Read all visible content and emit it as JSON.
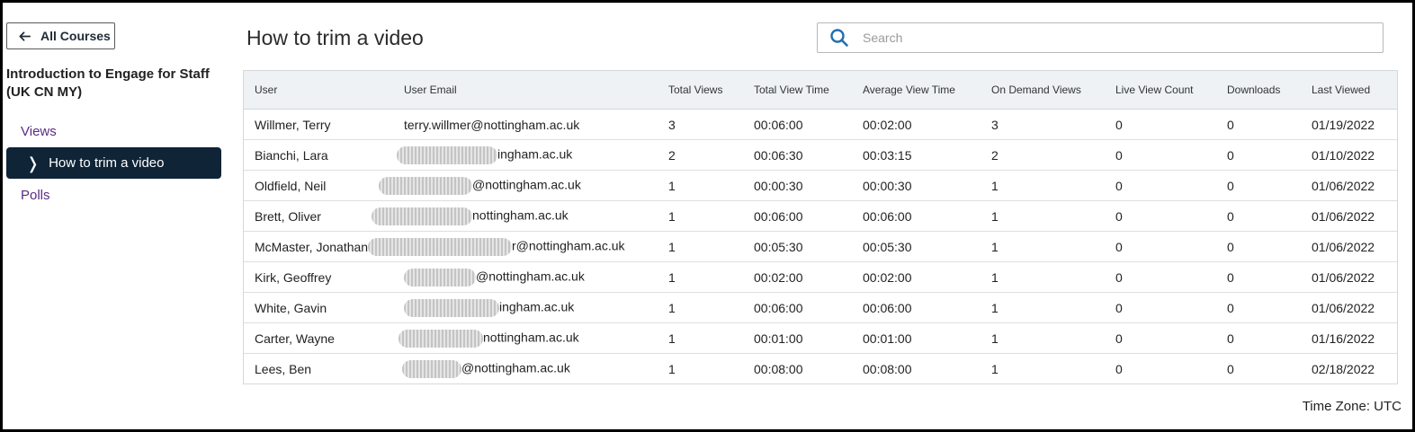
{
  "sidebar": {
    "back_label": "All Courses",
    "course_title": "Introduction to Engage for Staff (UK CN MY)",
    "items": [
      {
        "label": "Views",
        "active": false
      },
      {
        "label": "How to trim a video",
        "active": true
      },
      {
        "label": "Polls",
        "active": false
      }
    ]
  },
  "header": {
    "title": "How to trim a video",
    "search_placeholder": "Search"
  },
  "table": {
    "columns": [
      "User",
      "User Email",
      "Total Views",
      "Total View Time",
      "Average View Time",
      "On Demand Views",
      "Live View Count",
      "Downloads",
      "Last Viewed"
    ],
    "rows": [
      {
        "user": "Willmer, Terry",
        "email_visible": "terry.willmer@nottingham.ac.uk",
        "total_views": "3",
        "total_view_time": "00:06:00",
        "avg_view_time": "00:02:00",
        "on_demand": "3",
        "live": "0",
        "downloads": "0",
        "last_viewed": "01/19/2022"
      },
      {
        "user": "Bianchi, Lara",
        "email_visible": "ingham.ac.uk",
        "total_views": "2",
        "total_view_time": "00:06:30",
        "avg_view_time": "00:03:15",
        "on_demand": "2",
        "live": "0",
        "downloads": "0",
        "last_viewed": "01/10/2022"
      },
      {
        "user": "Oldfield, Neil",
        "email_visible": "@nottingham.ac.uk",
        "total_views": "1",
        "total_view_time": "00:00:30",
        "avg_view_time": "00:00:30",
        "on_demand": "1",
        "live": "0",
        "downloads": "0",
        "last_viewed": "01/06/2022"
      },
      {
        "user": "Brett, Oliver",
        "email_visible": "nottingham.ac.uk",
        "total_views": "1",
        "total_view_time": "00:06:00",
        "avg_view_time": "00:06:00",
        "on_demand": "1",
        "live": "0",
        "downloads": "0",
        "last_viewed": "01/06/2022"
      },
      {
        "user": "McMaster, Jonathan",
        "email_visible": "r@nottingham.ac.uk",
        "total_views": "1",
        "total_view_time": "00:05:30",
        "avg_view_time": "00:05:30",
        "on_demand": "1",
        "live": "0",
        "downloads": "0",
        "last_viewed": "01/06/2022"
      },
      {
        "user": "Kirk, Geoffrey",
        "email_visible": "@nottingham.ac.uk",
        "total_views": "1",
        "total_view_time": "00:02:00",
        "avg_view_time": "00:02:00",
        "on_demand": "1",
        "live": "0",
        "downloads": "0",
        "last_viewed": "01/06/2022"
      },
      {
        "user": "White, Gavin",
        "email_visible": "ingham.ac.uk",
        "total_views": "1",
        "total_view_time": "00:06:00",
        "avg_view_time": "00:06:00",
        "on_demand": "1",
        "live": "0",
        "downloads": "0",
        "last_viewed": "01/06/2022"
      },
      {
        "user": "Carter, Wayne",
        "email_visible": "nottingham.ac.uk",
        "total_views": "1",
        "total_view_time": "00:01:00",
        "avg_view_time": "00:01:00",
        "on_demand": "1",
        "live": "0",
        "downloads": "0",
        "last_viewed": "01/16/2022"
      },
      {
        "user": "Lees, Ben",
        "email_visible": "@nottingham.ac.uk",
        "total_views": "1",
        "total_view_time": "00:08:00",
        "avg_view_time": "00:08:00",
        "on_demand": "1",
        "live": "0",
        "downloads": "0",
        "last_viewed": "02/18/2022"
      }
    ]
  },
  "footer": {
    "timezone": "Time Zone: UTC"
  },
  "colors": {
    "active_nav_bg": "#0f2437",
    "nav_link": "#5b2a86",
    "search_icon": "#1f6fb2",
    "header_bg": "#eef2f5"
  },
  "icons": {
    "back": "arrow-left-icon",
    "search": "search-icon",
    "active_item": "chevron-right-icon"
  }
}
